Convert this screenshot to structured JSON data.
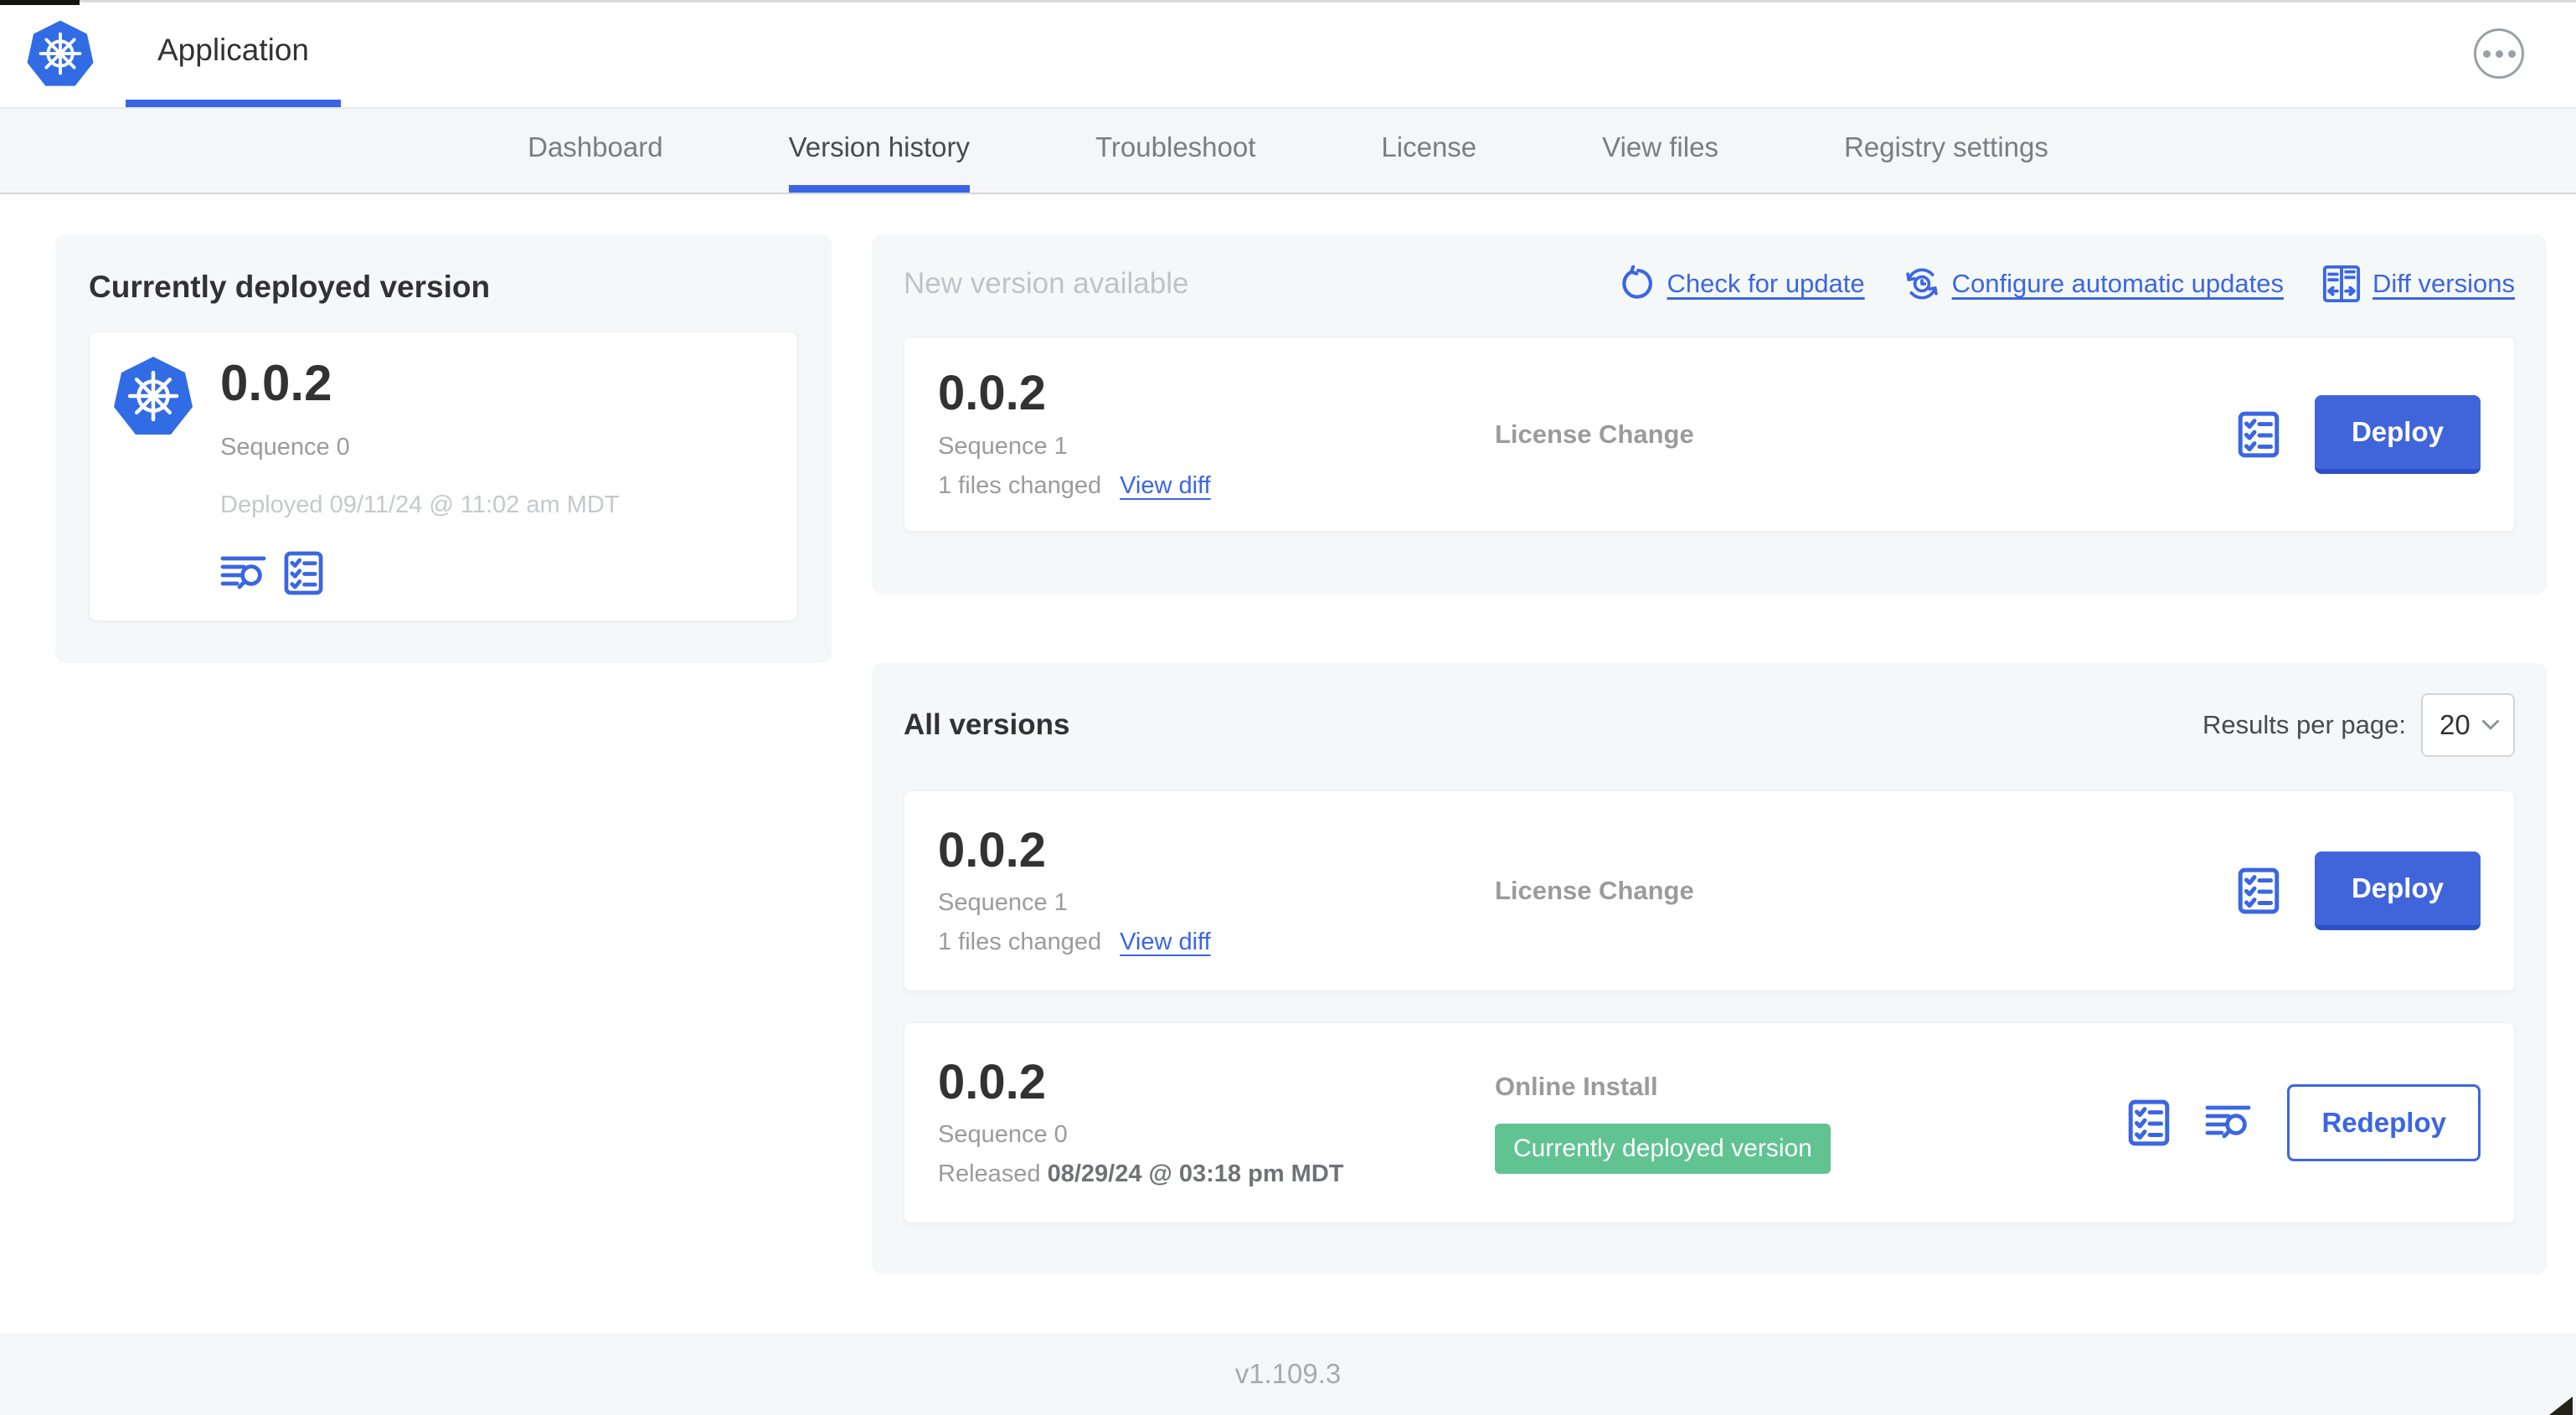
{
  "header": {
    "title": "Application",
    "menu_icon": "ellipsis"
  },
  "nav": {
    "tabs": [
      "Dashboard",
      "Version history",
      "Troubleshoot",
      "License",
      "View files",
      "Registry settings"
    ],
    "active_tab": "Version history"
  },
  "current_version_panel": {
    "title": "Currently deployed version",
    "version": "0.0.2",
    "sequence": "Sequence 0",
    "deployed_timestamp": "Deployed 09/11/24 @ 11:02 am MDT"
  },
  "new_version_panel": {
    "title": "New version available",
    "check_for_update_label": "Check for update",
    "configure_updates_label": "Configure automatic updates",
    "diff_versions_label": "Diff versions",
    "card": {
      "version": "0.0.2",
      "sequence": "Sequence 1",
      "files_changed": "1 files changed",
      "view_diff_label": "View diff",
      "release_notes": "License Change",
      "deploy_label": "Deploy"
    }
  },
  "all_versions_panel": {
    "title": "All versions",
    "results_per_page_label": "Results per page:",
    "results_per_page_value": "20",
    "rows": [
      {
        "version": "0.0.2",
        "sequence": "Sequence 1",
        "files_changed": "1 files changed",
        "view_diff_label": "View diff",
        "release_notes": "License Change",
        "action_label": "Deploy"
      },
      {
        "version": "0.0.2",
        "sequence": "Sequence 0",
        "released_prefix": "Released",
        "released_timestamp": "08/29/24 @ 03:18 pm MDT",
        "release_notes": "Online Install",
        "status_badge": "Currently deployed version",
        "action_label": "Redeploy"
      }
    ]
  },
  "footer": {
    "admin_console_version": "v1.109.3"
  },
  "colors": {
    "primary_blue": "#3b66e3",
    "button_blue": "#4065db",
    "kubernetes_blue": "#326ce5",
    "badge_green": "#61c392",
    "panel_gray": "#f5f8f9",
    "muted_text": "#9b9b9b"
  }
}
